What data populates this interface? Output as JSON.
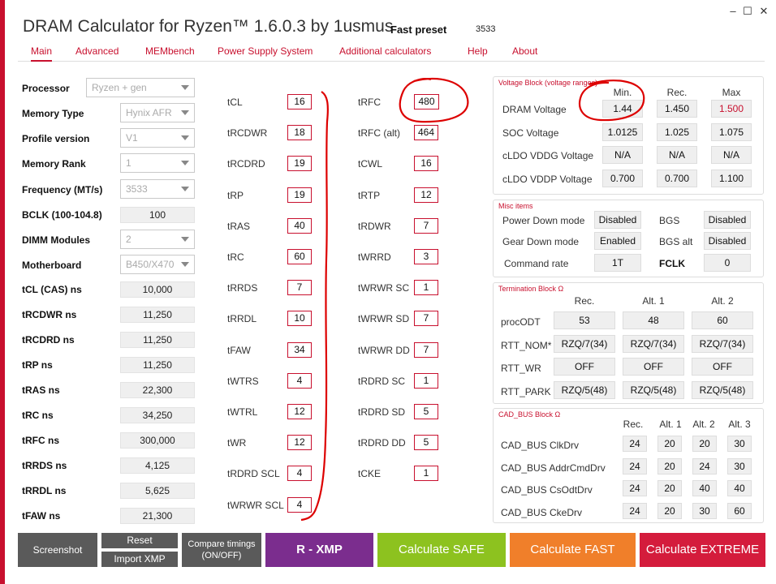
{
  "window": {
    "title": "DRAM Calculator for Ryzen™ 1.6.0.3 by 1usmus",
    "preset": "Fast preset",
    "frequency": "3533",
    "minimize": "–",
    "maximize": "☐",
    "close": "✕"
  },
  "tabs": [
    "Main",
    "Advanced",
    "MEMbench",
    "Power Supply System",
    "Additional calculators",
    "Help",
    "About"
  ],
  "left": {
    "processor": {
      "label": "Processor",
      "value": "Ryzen + gen"
    },
    "memory_type": {
      "label": "Memory Type",
      "value": "Hynix AFR"
    },
    "profile_version": {
      "label": "Profile version",
      "value": "V1"
    },
    "memory_rank": {
      "label": "Memory Rank",
      "value": "1"
    },
    "frequency": {
      "label": "Frequency (MT/s)",
      "value": "3533"
    },
    "bclk": {
      "label": "BCLK (100-104.8)",
      "value": "100"
    },
    "dimm_modules": {
      "label": "DIMM Modules",
      "value": "2"
    },
    "motherboard": {
      "label": "Motherboard",
      "value": "B450/X470"
    },
    "ns": [
      {
        "label": "tCL (CAS) ns",
        "value": "10,000"
      },
      {
        "label": "tRCDWR ns",
        "value": "11,250"
      },
      {
        "label": "tRCDRD ns",
        "value": "11,250"
      },
      {
        "label": "tRP ns",
        "value": "11,250"
      },
      {
        "label": "tRAS ns",
        "value": "22,300"
      },
      {
        "label": "tRC ns",
        "value": "34,250"
      },
      {
        "label": "tRFC ns",
        "value": "300,000"
      },
      {
        "label": "tRRDS ns",
        "value": "4,125"
      },
      {
        "label": "tRRDL ns",
        "value": "5,625"
      },
      {
        "label": "tFAW ns",
        "value": "21,300"
      }
    ]
  },
  "timings_col1": [
    {
      "name": "tCL",
      "value": "16"
    },
    {
      "name": "tRCDWR",
      "value": "18"
    },
    {
      "name": "tRCDRD",
      "value": "19"
    },
    {
      "name": "tRP",
      "value": "19"
    },
    {
      "name": "tRAS",
      "value": "40"
    },
    {
      "name": "tRC",
      "value": "60"
    },
    {
      "name": "tRRDS",
      "value": "7"
    },
    {
      "name": "tRRDL",
      "value": "10"
    },
    {
      "name": "tFAW",
      "value": "34"
    },
    {
      "name": "tWTRS",
      "value": "4"
    },
    {
      "name": "tWTRL",
      "value": "12"
    },
    {
      "name": "tWR",
      "value": "12"
    },
    {
      "name": "tRDRD SCL",
      "value": "4"
    },
    {
      "name": "tWRWR SCL",
      "value": "4"
    }
  ],
  "timings_col2": [
    {
      "name": "tRFC",
      "value": "480"
    },
    {
      "name": "tRFC (alt)",
      "value": "464"
    },
    {
      "name": "tCWL",
      "value": "16"
    },
    {
      "name": "tRTP",
      "value": "12"
    },
    {
      "name": "tRDWR",
      "value": "7"
    },
    {
      "name": "tWRRD",
      "value": "3"
    },
    {
      "name": "tWRWR SC",
      "value": "1"
    },
    {
      "name": "tWRWR SD",
      "value": "7"
    },
    {
      "name": "tWRWR DD",
      "value": "7"
    },
    {
      "name": "tRDRD SC",
      "value": "1"
    },
    {
      "name": "tRDRD SD",
      "value": "5"
    },
    {
      "name": "tRDRD DD",
      "value": "5"
    },
    {
      "name": "tCKE",
      "value": "1"
    }
  ],
  "voltage": {
    "title": "Voltage Block (voltage ranges)",
    "headers": [
      "Min.",
      "Rec.",
      "Max"
    ],
    "rows": [
      {
        "label": "DRAM Voltage",
        "values": [
          "1.44",
          "1.450",
          "1.500"
        ]
      },
      {
        "label": "SOC Voltage",
        "values": [
          "1.0125",
          "1.025",
          "1.075"
        ]
      },
      {
        "label": "cLDO VDDG Voltage",
        "values": [
          "N/A",
          "N/A",
          "N/A"
        ]
      },
      {
        "label": "cLDO VDDP Voltage",
        "values": [
          "0.700",
          "0.700",
          "1.100"
        ]
      }
    ]
  },
  "misc": {
    "title": "Misc items",
    "power_down": {
      "label": "Power Down mode",
      "value": "Disabled"
    },
    "bgs": {
      "label": "BGS",
      "value": "Disabled"
    },
    "gear_down": {
      "label": "Gear Down mode",
      "value": "Enabled"
    },
    "bgs_alt": {
      "label": "BGS alt",
      "value": "Disabled"
    },
    "command_rate": {
      "label": "Command rate",
      "value": "1T"
    },
    "fclk": {
      "label": "FCLK",
      "value": "0"
    }
  },
  "termination": {
    "title": "Termination Block Ω",
    "headers": [
      "Rec.",
      "Alt. 1",
      "Alt. 2"
    ],
    "rows": [
      {
        "label": "procODT",
        "values": [
          "53",
          "48",
          "60"
        ]
      },
      {
        "label": "RTT_NOM*",
        "values": [
          "RZQ/7(34)",
          "RZQ/7(34)",
          "RZQ/7(34)"
        ]
      },
      {
        "label": "RTT_WR",
        "values": [
          "OFF",
          "OFF",
          "OFF"
        ]
      },
      {
        "label": "RTT_PARK",
        "values": [
          "RZQ/5(48)",
          "RZQ/5(48)",
          "RZQ/5(48)"
        ]
      }
    ]
  },
  "cadbus": {
    "title": "CAD_BUS Block Ω",
    "headers": [
      "Rec.",
      "Alt. 1",
      "Alt. 2",
      "Alt. 3"
    ],
    "rows": [
      {
        "label": "CAD_BUS ClkDrv",
        "values": [
          "24",
          "20",
          "20",
          "30"
        ]
      },
      {
        "label": "CAD_BUS AddrCmdDrv",
        "values": [
          "24",
          "20",
          "24",
          "30"
        ]
      },
      {
        "label": "CAD_BUS CsOdtDrv",
        "values": [
          "24",
          "20",
          "40",
          "40"
        ]
      },
      {
        "label": "CAD_BUS CkeDrv",
        "values": [
          "24",
          "20",
          "30",
          "60"
        ]
      }
    ]
  },
  "buttons": {
    "screenshot": "Screenshot",
    "reset": "Reset",
    "import_xmp": "Import XMP",
    "compare": "Compare timings (ON/OFF)",
    "rxmp": "R - XMP",
    "safe": "Calculate SAFE",
    "fast": "Calculate FAST",
    "extreme": "Calculate EXTREME"
  },
  "colors": {
    "accent": "#c8102e",
    "grey_button": "#5a5a5a",
    "purple": "#7b2d8e",
    "green": "#8dc21f",
    "orange": "#f07f2a",
    "red": "#d41c3c"
  }
}
